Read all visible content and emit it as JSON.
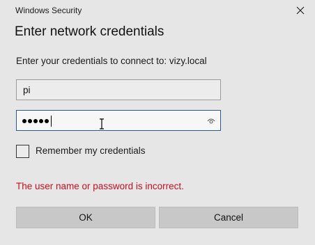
{
  "window": {
    "app_title": "Windows Security",
    "close_icon": "close-icon"
  },
  "heading": "Enter network credentials",
  "prompt": "Enter your credentials to connect to: vizy.local",
  "username": {
    "value": "pi"
  },
  "password": {
    "masked_value": "•••••",
    "char_count": 5,
    "reveal_icon": "eye-icon"
  },
  "remember": {
    "label": "Remember my credentials",
    "checked": false
  },
  "error_message": "The user name or password is incorrect.",
  "buttons": {
    "ok": "OK",
    "cancel": "Cancel"
  },
  "colors": {
    "error": "#c50f1f",
    "focus_border": "#2b5797",
    "background": "#e6e6e6"
  }
}
